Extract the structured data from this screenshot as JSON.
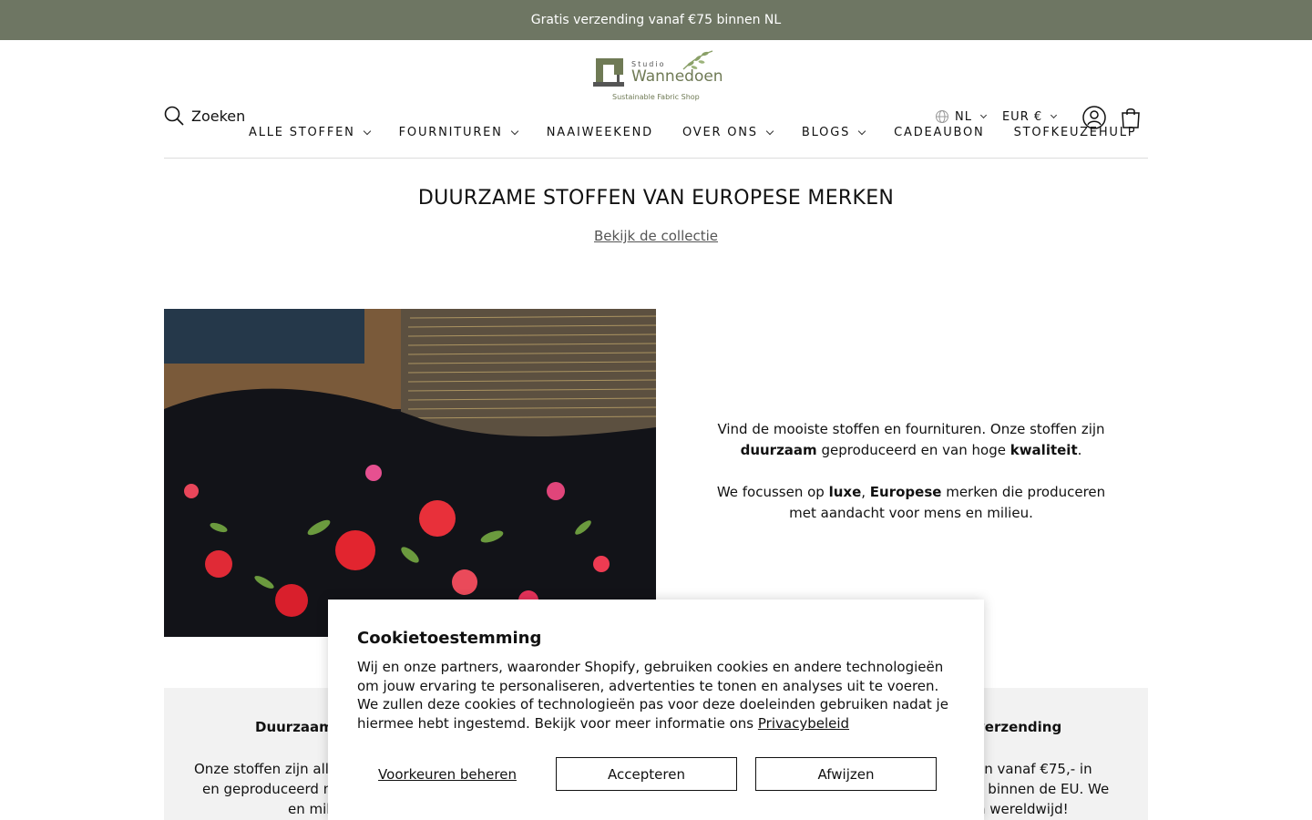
{
  "announcement": "Gratis verzending vanaf €75 binnen NL",
  "logo": {
    "small": "Studio",
    "main": "Wannedoen",
    "tagline": "Sustainable Fabric Shop"
  },
  "header": {
    "search_label": "Zoeken",
    "nav": [
      {
        "label": "ALLE STOFFEN",
        "dropdown": true
      },
      {
        "label": "FOURNITUREN",
        "dropdown": true
      },
      {
        "label": "NAAIWEEKEND",
        "dropdown": false
      },
      {
        "label": "OVER ONS",
        "dropdown": true
      },
      {
        "label": "BLOGS",
        "dropdown": true
      },
      {
        "label": "CADEAUBON",
        "dropdown": false
      },
      {
        "label": "STOFKEUZEHULP",
        "dropdown": false
      }
    ],
    "language": "NL",
    "currency": "EUR €"
  },
  "hero": {
    "title": "DUURZAME STOFFEN VAN EUROPESE MERKEN",
    "link": "Bekijk de collectie"
  },
  "feature": {
    "p1_a": "Vind de mooiste stoffen en fournituren. Onze stoffen zijn ",
    "p1_b": "duurzaam",
    "p1_c": " geproduceerd en van hoge ",
    "p1_d": "kwaliteit",
    "p1_e": ".",
    "p2_a": "We focussen op ",
    "p2_b": "luxe",
    "p2_c": ", ",
    "p2_d": "Europese",
    "p2_e": " merken die produceren met aandacht voor mens en milieu."
  },
  "usp": {
    "col1_title": "Duurzaam &",
    "col1_l1": "Onze stoffen zijn aller",
    "col1_l2": "en geproduceerd me",
    "col1_l3": "en mili",
    "col2_title": "verzending",
    "col2_l1": "en vanaf €75,- in",
    "col2_l2": "5 binnen de EU. We",
    "col2_l3": "n wereldwijd!"
  },
  "cookie": {
    "title": "Cookietoestemming",
    "body": "Wij en onze partners, waaronder Shopify, gebruiken cookies en andere technologieën om jouw ervaring te personaliseren, advertenties te tonen en analyses uit te voeren. We zullen deze cookies of technologieën pas voor deze doeleinden gebruiken nadat je hiermee hebt ingestemd. Bekijk voor meer informatie ons ",
    "privacy_link": "Privacybeleid",
    "manage": "Voorkeuren beheren",
    "accept": "Accepteren",
    "decline": "Afwijzen"
  },
  "colors": {
    "announcement_bg": "#6e7663",
    "brand_green": "#6f7a55",
    "usp_bg": "#f2f2f2"
  }
}
